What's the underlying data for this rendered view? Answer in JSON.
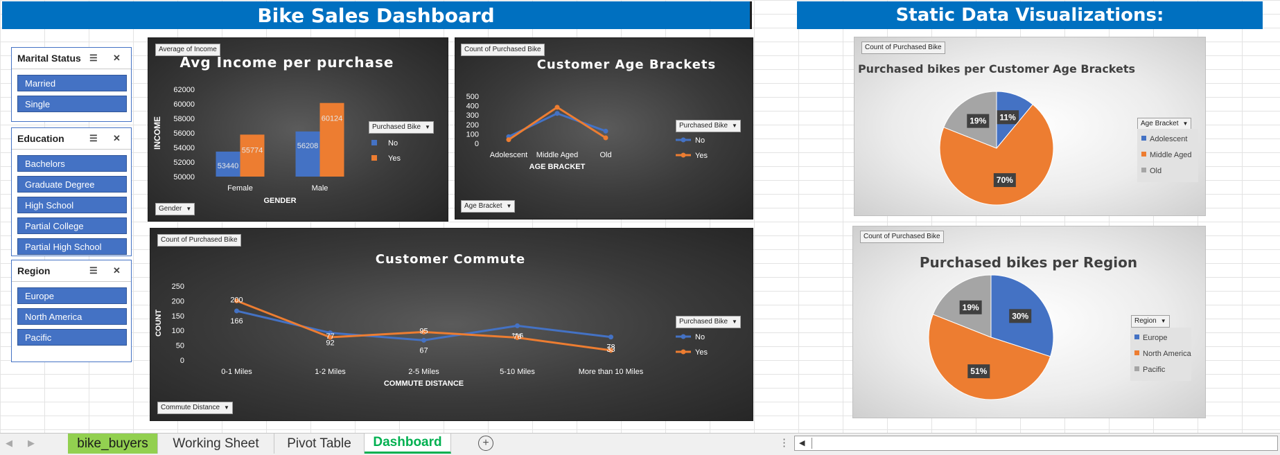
{
  "header": {
    "title": "Bike Sales Dashboard",
    "static_title": "Static Data Visualizations:"
  },
  "slicers": [
    {
      "title": "Marital Status",
      "items": [
        "Married",
        "Single"
      ]
    },
    {
      "title": "Education",
      "items": [
        "Bachelors",
        "Graduate Degree",
        "High School",
        "Partial College",
        "Partial High School"
      ]
    },
    {
      "title": "Region",
      "items": [
        "Europe",
        "North America",
        "Pacific"
      ]
    }
  ],
  "icons": {
    "multiselect": "multiselect-icon",
    "clear_filter": "clear-filter-icon",
    "dropdown": "dropdown-arrow-icon",
    "add_sheet": "plus-circle-icon"
  },
  "colors": {
    "accent": "#0070C0",
    "series_no": "#4472C4",
    "series_yes": "#ED7D31",
    "series_gray": "#A5A5A5",
    "tab_active": "#00B050",
    "tab_green": "#92D050"
  },
  "charts": {
    "income": {
      "field_button": "Average of Income",
      "axis_button": "Gender",
      "legend_button": "Purchased Bike"
    },
    "age": {
      "field_button": "Count of Purchased Bike",
      "axis_button": "Age Bracket",
      "legend_button": "Purchased Bike"
    },
    "commute": {
      "field_button": "Count of Purchased Bike",
      "axis_button": "Commute Distance",
      "legend_button": "Purchased Bike"
    },
    "pie_age": {
      "field_button": "Count of Purchased Bike",
      "legend_button": "Age Bracket"
    },
    "pie_region": {
      "field_button": "Count of Purchased Bike",
      "legend_button": "Region"
    }
  },
  "chart_data": [
    {
      "type": "bar",
      "title": "Avg Income per purchase",
      "xlabel": "GENDER",
      "ylabel": "INCOME",
      "categories": [
        "Female",
        "Male"
      ],
      "series": [
        {
          "name": "No",
          "values": [
            53440,
            56208
          ]
        },
        {
          "name": "Yes",
          "values": [
            55774,
            60124
          ]
        }
      ],
      "ylim": [
        50000,
        62000
      ],
      "yticks": [
        50000,
        52000,
        54000,
        56000,
        58000,
        60000,
        62000
      ],
      "legend": "right",
      "data_labels": true
    },
    {
      "type": "line",
      "title": "Customer Age Brackets",
      "xlabel": "AGE BRACKET",
      "ylabel": "",
      "categories": [
        "Adolescent",
        "Middle Aged",
        "Old"
      ],
      "series": [
        {
          "name": "No",
          "values": [
            71,
            318,
            130
          ]
        },
        {
          "name": "Yes",
          "values": [
            39,
            383,
            59
          ]
        }
      ],
      "ylim": [
        0,
        500
      ],
      "yticks": [
        0,
        100,
        200,
        300,
        400,
        500
      ],
      "legend": "right"
    },
    {
      "type": "line",
      "title": "Customer Commute",
      "xlabel": "COMMUTE DISTANCE",
      "ylabel": "COUNT",
      "categories": [
        "0-1 Miles",
        "1-2 Miles",
        "2-5 Miles",
        "5-10 Miles",
        "More than 10 Miles"
      ],
      "series": [
        {
          "name": "No",
          "values": [
            166,
            92,
            67,
            116,
            78
          ]
        },
        {
          "name": "Yes",
          "values": [
            200,
            77,
            95,
            76,
            33
          ]
        }
      ],
      "ylim": [
        0,
        250
      ],
      "yticks": [
        0,
        50,
        100,
        150,
        200,
        250
      ],
      "legend": "right",
      "data_labels": true
    },
    {
      "type": "pie",
      "title": "Purchased bikes per Customer Age Brackets",
      "categories": [
        "Adolescent",
        "Middle Aged",
        "Old"
      ],
      "values": [
        11,
        70,
        19
      ],
      "labels": [
        "11%",
        "70%",
        "19%"
      ],
      "legend": "right"
    },
    {
      "type": "pie",
      "title": "Purchased bikes per Region",
      "categories": [
        "Europe",
        "North America",
        "Pacific"
      ],
      "values": [
        30,
        51,
        19
      ],
      "labels": [
        "30%",
        "51%",
        "19%"
      ],
      "legend": "right"
    }
  ],
  "tabs": [
    {
      "label": "bike_buyers",
      "state": "green"
    },
    {
      "label": "Working Sheet",
      "state": "normal"
    },
    {
      "label": "Pivot Table",
      "state": "normal"
    },
    {
      "label": "Dashboard",
      "state": "active"
    }
  ]
}
